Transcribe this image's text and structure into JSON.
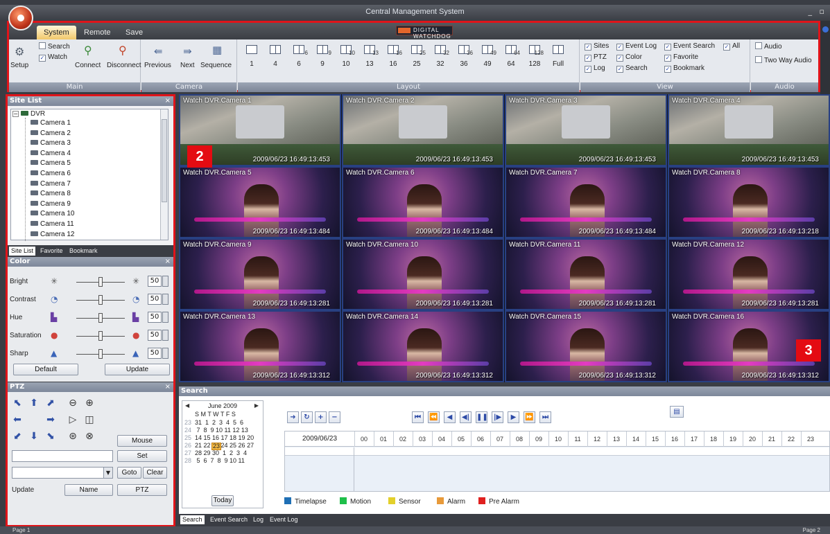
{
  "window": {
    "title": "Central Management System"
  },
  "ribbon": {
    "tabs": [
      "System",
      "Remote",
      "Save"
    ],
    "brand_text": "DIGITAL WATCHDOG",
    "main": {
      "title": "Main",
      "setup": "Setup",
      "search": "Search",
      "watch": "Watch",
      "connect": "Connect",
      "disconnect": "Disconnect"
    },
    "camera": {
      "title": "Camera",
      "previous": "Previous",
      "next": "Next",
      "sequence": "Sequence"
    },
    "layout": {
      "title": "Layout",
      "options": [
        "1",
        "4",
        "6",
        "9",
        "10",
        "13",
        "16",
        "25",
        "32",
        "36",
        "49",
        "64",
        "128",
        "Full"
      ],
      "icon_marks": [
        "",
        "",
        "6",
        "9",
        "10",
        "13",
        "16",
        "25",
        "32",
        "36",
        "49",
        "64",
        "128",
        ""
      ]
    },
    "view": {
      "title": "View",
      "sites": "Sites",
      "event_log": "Event Log",
      "event_search": "Event Search",
      "all": "All",
      "ptz": "PTZ",
      "color": "Color",
      "favorite": "Favorite",
      "log": "Log",
      "search": "Search",
      "bookmark": "Bookmark"
    },
    "audio": {
      "title": "Audio",
      "audio": "Audio",
      "two_way": "Two Way Audio"
    }
  },
  "annotations": {
    "two": "2",
    "three": "3"
  },
  "site_list": {
    "title": "Site List",
    "close": "×",
    "root": "DVR",
    "cameras": [
      "Camera 1",
      "Camera 2",
      "Camera 3",
      "Camera 4",
      "Camera 5",
      "Camera 6",
      "Camera 7",
      "Camera 8",
      "Camera 9",
      "Camera 10",
      "Camera 11",
      "Camera 12"
    ],
    "tabs": [
      "Site List",
      "Favorite",
      "Bookmark"
    ]
  },
  "color_panel": {
    "title": "Color",
    "close": "×",
    "rows": [
      {
        "label": "Bright",
        "value": "50",
        "level": 0.5
      },
      {
        "label": "Contrast",
        "value": "50",
        "level": 0.5
      },
      {
        "label": "Hue",
        "value": "50",
        "level": 0.5
      },
      {
        "label": "Saturation",
        "value": "50",
        "level": 0.5
      },
      {
        "label": "Sharp",
        "value": "50",
        "level": 0.5
      }
    ],
    "default": "Default",
    "update": "Update"
  },
  "ptz_panel": {
    "title": "PTZ",
    "close": "×",
    "mouse": "Mouse",
    "set": "Set",
    "goto": "Goto",
    "clear": "Clear",
    "update": "Update",
    "name": "Name",
    "ptz": "PTZ"
  },
  "cameras": [
    {
      "label": "Watch DVR.Camera  1",
      "time": "2009/06/23 16:49:13:453",
      "scene": "lab"
    },
    {
      "label": "Watch DVR.Camera  2",
      "time": "2009/06/23 16:49:13:453",
      "scene": "lab"
    },
    {
      "label": "Watch DVR.Camera  3",
      "time": "2009/06/23 16:49:13:453",
      "scene": "lab"
    },
    {
      "label": "Watch DVR.Camera  4",
      "time": "2009/06/23 16:49:13:453",
      "scene": "lab"
    },
    {
      "label": "Watch DVR.Camera  5",
      "time": "2009/06/23 16:49:13:484",
      "scene": "stage"
    },
    {
      "label": "Watch DVR.Camera  6",
      "time": "2009/06/23 16:49:13:484",
      "scene": "stage"
    },
    {
      "label": "Watch DVR.Camera  7",
      "time": "2009/06/23 16:49:13:484",
      "scene": "stage"
    },
    {
      "label": "Watch DVR.Camera  8",
      "time": "2009/06/23 16:49:13:218",
      "scene": "stage"
    },
    {
      "label": "Watch DVR.Camera  9",
      "time": "2009/06/23 16:49:13:281",
      "scene": "stage"
    },
    {
      "label": "Watch DVR.Camera 10",
      "time": "2009/06/23 16:49:13:281",
      "scene": "stage"
    },
    {
      "label": "Watch DVR.Camera 11",
      "time": "2009/06/23 16:49:13:281",
      "scene": "stage"
    },
    {
      "label": "Watch DVR.Camera 12",
      "time": "2009/06/23 16:49:13:281",
      "scene": "stage"
    },
    {
      "label": "Watch DVR.Camera 13",
      "time": "2009/06/23 16:49:13:312",
      "scene": "stage"
    },
    {
      "label": "Watch DVR.Camera 14",
      "time": "2009/06/23 16:49:13:312",
      "scene": "stage"
    },
    {
      "label": "Watch DVR.Camera 15",
      "time": "2009/06/23 16:49:13:312",
      "scene": "stage"
    },
    {
      "label": "Watch DVR.Camera 16",
      "time": "2009/06/23 16:49:13:312",
      "scene": "stage"
    }
  ],
  "search_panel": {
    "title": "Search",
    "calendar": {
      "month": "June 2009",
      "dow": "S M T W T F S",
      "weeks": [
        {
          "wk": "23",
          "days": "31  1  2  3  4  5  6"
        },
        {
          "wk": "24",
          "days": " 7  8  9 10 11 12 13"
        },
        {
          "wk": "25",
          "days": "14 15 16 17 18 19 20"
        },
        {
          "wk": "26",
          "days": "21 22 23 24 25 26 27"
        },
        {
          "wk": "27",
          "days": "28 29 30  1  2  3  4"
        },
        {
          "wk": "28",
          "days": " 5  6  7  8  9 10 11"
        }
      ],
      "selected_day": "23",
      "today": "Today"
    },
    "date": "2009/06/23",
    "hours": [
      "00",
      "01",
      "02",
      "03",
      "04",
      "05",
      "06",
      "07",
      "08",
      "09",
      "10",
      "11",
      "12",
      "13",
      "14",
      "15",
      "16",
      "17",
      "18",
      "19",
      "20",
      "21",
      "22",
      "23"
    ],
    "legend": [
      {
        "name": "Timelapse",
        "color": "#1f6fb5"
      },
      {
        "name": "Motion",
        "color": "#1fbf4a"
      },
      {
        "name": "Sensor",
        "color": "#e3d02b"
      },
      {
        "name": "Alarm",
        "color": "#e89a3a"
      },
      {
        "name": "Pre Alarm",
        "color": "#e0201f"
      }
    ]
  },
  "bottom_tabs": [
    "Search",
    "Event Search",
    "Log",
    "Event Log"
  ],
  "status": {
    "left": "Page 1",
    "right": "Page 2"
  }
}
